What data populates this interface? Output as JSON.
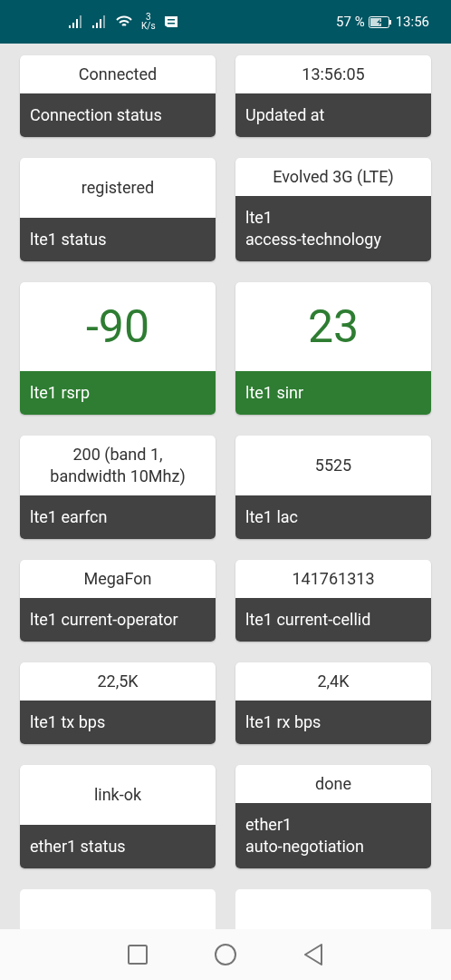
{
  "status_bar": {
    "net_speed_value": "3",
    "net_speed_unit": "K/s",
    "battery": "57 %",
    "time": "13:56"
  },
  "rows": [
    [
      {
        "value": "Connected",
        "label": "Connection status",
        "highlighted": false
      },
      {
        "value": "13:56:05",
        "label": "Updated at",
        "highlighted": false
      }
    ],
    [
      {
        "value": "registered",
        "label": "lte1 status",
        "highlighted": false
      },
      {
        "value": "Evolved 3G (LTE)",
        "label": "lte1\naccess-technology",
        "highlighted": false
      }
    ],
    [
      {
        "value": "-90",
        "label": "lte1 rsrp",
        "highlighted": true
      },
      {
        "value": "23",
        "label": "lte1 sinr",
        "highlighted": true
      }
    ],
    [
      {
        "value": "200 (band 1,\nbandwidth 10Mhz)",
        "label": "lte1 earfcn",
        "highlighted": false
      },
      {
        "value": "5525",
        "label": "lte1 lac",
        "highlighted": false
      }
    ],
    [
      {
        "value": "MegaFon",
        "label": "lte1 current-operator",
        "highlighted": false
      },
      {
        "value": "141761313",
        "label": "lte1 current-cellid",
        "highlighted": false
      }
    ],
    [
      {
        "value": "22,5K",
        "label": "lte1 tx bps",
        "highlighted": false
      },
      {
        "value": "2,4K",
        "label": "lte1 rx bps",
        "highlighted": false
      }
    ],
    [
      {
        "value": "link-ok",
        "label": "ether1 status",
        "highlighted": false
      },
      {
        "value": "done",
        "label": "ether1\nauto-negotiation",
        "highlighted": false
      }
    ]
  ]
}
